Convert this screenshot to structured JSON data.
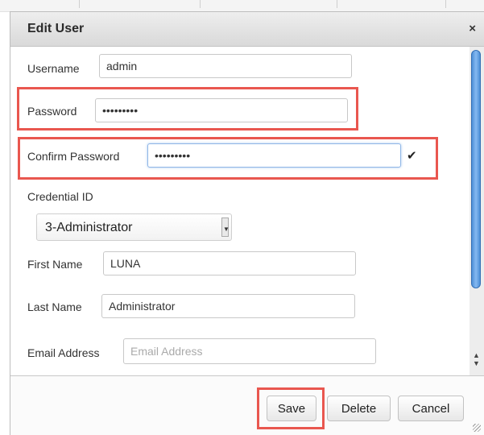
{
  "dialog": {
    "title": "Edit User",
    "close_symbol": "×"
  },
  "form": {
    "username": {
      "label": "Username",
      "value": "admin"
    },
    "password": {
      "label": "Password",
      "value": "•••••••••"
    },
    "confirm_password": {
      "label": "Confirm Password",
      "value": "•••••••••",
      "check_symbol": "✔"
    },
    "credential": {
      "label": "Credential ID",
      "selected": "3-Administrator"
    },
    "first_name": {
      "label": "First Name",
      "value": "LUNA"
    },
    "last_name": {
      "label": "Last Name",
      "value": "Administrator"
    },
    "email": {
      "label": "Email Address",
      "placeholder": "Email Address"
    }
  },
  "buttons": {
    "save": "Save",
    "delete": "Delete",
    "cancel": "Cancel"
  },
  "icons": {
    "close": "close-icon",
    "check": "checkmark-icon",
    "dropdown": "chevron-down-icon",
    "resize": "resize-grip-icon"
  },
  "colors": {
    "highlight": "#e9574f",
    "scroll_thumb": "#5b9be0",
    "focus_border": "#8fb6e6"
  }
}
